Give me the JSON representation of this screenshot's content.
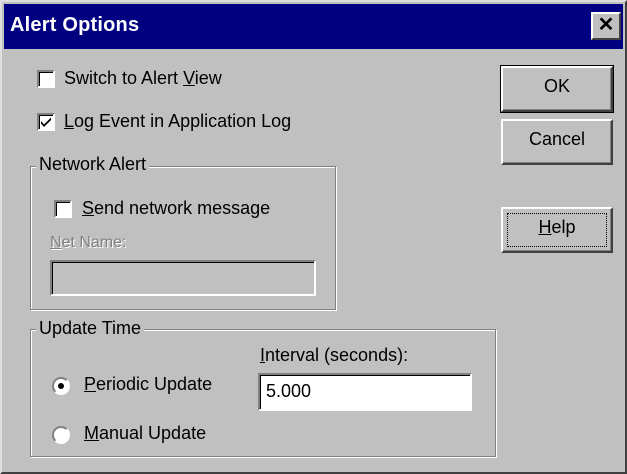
{
  "window": {
    "title": "Alert Options",
    "close_glyph": "✕"
  },
  "options": {
    "switch_view": {
      "label_pre": "Switch to Alert ",
      "label_u": "V",
      "label_post": "iew",
      "checked": false
    },
    "log_event": {
      "label_pre": "",
      "label_u": "L",
      "label_post": "og Event in Application Log",
      "checked": true
    }
  },
  "network_alert": {
    "group_label": "Network Alert",
    "send_message": {
      "label_pre": "",
      "label_u": "S",
      "label_post": "end network message",
      "checked": false
    },
    "net_name_label_u": "N",
    "net_name_label_post": "et Name:",
    "net_name_value": ""
  },
  "update_time": {
    "group_label": "Update Time",
    "interval_label_u": "I",
    "interval_label_post": "nterval (seconds):",
    "interval_value": "5.000",
    "periodic": {
      "label_pre": "",
      "label_u": "P",
      "label_post": "eriodic Update",
      "selected": true
    },
    "manual": {
      "label_pre": "",
      "label_u": "M",
      "label_post": "anual Update",
      "selected": false
    }
  },
  "buttons": {
    "ok": "OK",
    "cancel": "Cancel",
    "help_u": "H",
    "help_post": "elp"
  },
  "colors": {
    "titlebar": "#000080",
    "face": "#c0c0c0"
  },
  "icons": {
    "close": "close-icon",
    "check": "checkmark-icon",
    "radio_dot": "radio-dot-icon"
  }
}
